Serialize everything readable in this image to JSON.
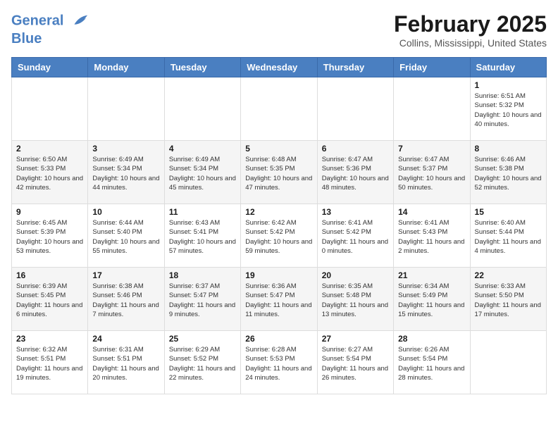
{
  "header": {
    "logo_line1": "General",
    "logo_line2": "Blue",
    "month_year": "February 2025",
    "location": "Collins, Mississippi, United States"
  },
  "days_of_week": [
    "Sunday",
    "Monday",
    "Tuesday",
    "Wednesday",
    "Thursday",
    "Friday",
    "Saturday"
  ],
  "weeks": [
    [
      {
        "day": "",
        "info": ""
      },
      {
        "day": "",
        "info": ""
      },
      {
        "day": "",
        "info": ""
      },
      {
        "day": "",
        "info": ""
      },
      {
        "day": "",
        "info": ""
      },
      {
        "day": "",
        "info": ""
      },
      {
        "day": "1",
        "info": "Sunrise: 6:51 AM\nSunset: 5:32 PM\nDaylight: 10 hours\nand 40 minutes."
      }
    ],
    [
      {
        "day": "2",
        "info": "Sunrise: 6:50 AM\nSunset: 5:33 PM\nDaylight: 10 hours\nand 42 minutes."
      },
      {
        "day": "3",
        "info": "Sunrise: 6:49 AM\nSunset: 5:34 PM\nDaylight: 10 hours\nand 44 minutes."
      },
      {
        "day": "4",
        "info": "Sunrise: 6:49 AM\nSunset: 5:34 PM\nDaylight: 10 hours\nand 45 minutes."
      },
      {
        "day": "5",
        "info": "Sunrise: 6:48 AM\nSunset: 5:35 PM\nDaylight: 10 hours\nand 47 minutes."
      },
      {
        "day": "6",
        "info": "Sunrise: 6:47 AM\nSunset: 5:36 PM\nDaylight: 10 hours\nand 48 minutes."
      },
      {
        "day": "7",
        "info": "Sunrise: 6:47 AM\nSunset: 5:37 PM\nDaylight: 10 hours\nand 50 minutes."
      },
      {
        "day": "8",
        "info": "Sunrise: 6:46 AM\nSunset: 5:38 PM\nDaylight: 10 hours\nand 52 minutes."
      }
    ],
    [
      {
        "day": "9",
        "info": "Sunrise: 6:45 AM\nSunset: 5:39 PM\nDaylight: 10 hours\nand 53 minutes."
      },
      {
        "day": "10",
        "info": "Sunrise: 6:44 AM\nSunset: 5:40 PM\nDaylight: 10 hours\nand 55 minutes."
      },
      {
        "day": "11",
        "info": "Sunrise: 6:43 AM\nSunset: 5:41 PM\nDaylight: 10 hours\nand 57 minutes."
      },
      {
        "day": "12",
        "info": "Sunrise: 6:42 AM\nSunset: 5:42 PM\nDaylight: 10 hours\nand 59 minutes."
      },
      {
        "day": "13",
        "info": "Sunrise: 6:41 AM\nSunset: 5:42 PM\nDaylight: 11 hours\nand 0 minutes."
      },
      {
        "day": "14",
        "info": "Sunrise: 6:41 AM\nSunset: 5:43 PM\nDaylight: 11 hours\nand 2 minutes."
      },
      {
        "day": "15",
        "info": "Sunrise: 6:40 AM\nSunset: 5:44 PM\nDaylight: 11 hours\nand 4 minutes."
      }
    ],
    [
      {
        "day": "16",
        "info": "Sunrise: 6:39 AM\nSunset: 5:45 PM\nDaylight: 11 hours\nand 6 minutes."
      },
      {
        "day": "17",
        "info": "Sunrise: 6:38 AM\nSunset: 5:46 PM\nDaylight: 11 hours\nand 7 minutes."
      },
      {
        "day": "18",
        "info": "Sunrise: 6:37 AM\nSunset: 5:47 PM\nDaylight: 11 hours\nand 9 minutes."
      },
      {
        "day": "19",
        "info": "Sunrise: 6:36 AM\nSunset: 5:47 PM\nDaylight: 11 hours\nand 11 minutes."
      },
      {
        "day": "20",
        "info": "Sunrise: 6:35 AM\nSunset: 5:48 PM\nDaylight: 11 hours\nand 13 minutes."
      },
      {
        "day": "21",
        "info": "Sunrise: 6:34 AM\nSunset: 5:49 PM\nDaylight: 11 hours\nand 15 minutes."
      },
      {
        "day": "22",
        "info": "Sunrise: 6:33 AM\nSunset: 5:50 PM\nDaylight: 11 hours\nand 17 minutes."
      }
    ],
    [
      {
        "day": "23",
        "info": "Sunrise: 6:32 AM\nSunset: 5:51 PM\nDaylight: 11 hours\nand 19 minutes."
      },
      {
        "day": "24",
        "info": "Sunrise: 6:31 AM\nSunset: 5:51 PM\nDaylight: 11 hours\nand 20 minutes."
      },
      {
        "day": "25",
        "info": "Sunrise: 6:29 AM\nSunset: 5:52 PM\nDaylight: 11 hours\nand 22 minutes."
      },
      {
        "day": "26",
        "info": "Sunrise: 6:28 AM\nSunset: 5:53 PM\nDaylight: 11 hours\nand 24 minutes."
      },
      {
        "day": "27",
        "info": "Sunrise: 6:27 AM\nSunset: 5:54 PM\nDaylight: 11 hours\nand 26 minutes."
      },
      {
        "day": "28",
        "info": "Sunrise: 6:26 AM\nSunset: 5:54 PM\nDaylight: 11 hours\nand 28 minutes."
      },
      {
        "day": "",
        "info": ""
      }
    ]
  ]
}
